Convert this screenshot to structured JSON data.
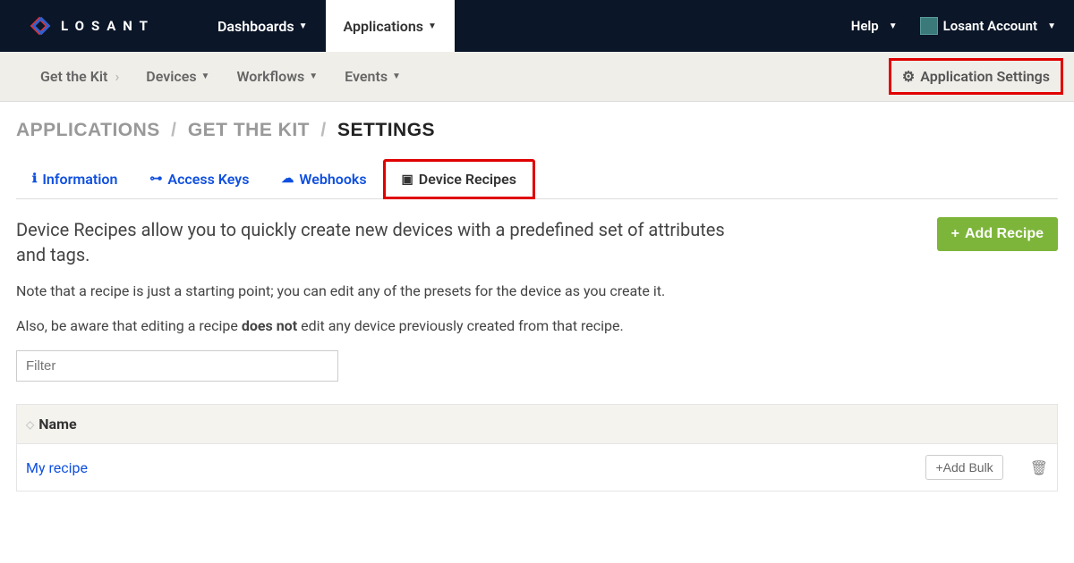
{
  "topnav": {
    "brand": "LOSANT",
    "dashboards": "Dashboards",
    "applications": "Applications",
    "help": "Help",
    "account": "Losant Account"
  },
  "subnav": {
    "kit": "Get the Kit",
    "devices": "Devices",
    "workflows": "Workflows",
    "events": "Events",
    "settings": "Application Settings"
  },
  "breadcrumb": {
    "p1": "APPLICATIONS",
    "p2": "GET THE KIT",
    "p3": "SETTINGS"
  },
  "tabs": {
    "information": "Information",
    "access_keys": "Access Keys",
    "webhooks": "Webhooks",
    "device_recipes": "Device Recipes"
  },
  "main": {
    "description": "Device Recipes allow you to quickly create new devices with a predefined set of attributes and tags.",
    "add_recipe": "Add Recipe",
    "note1": "Note that a recipe is just a starting point; you can edit any of the presets for the device as you create it.",
    "note2_a": "Also, be aware that editing a recipe ",
    "note2_bold": "does not",
    "note2_b": " edit any device previously created from that recipe.",
    "filter_placeholder": "Filter"
  },
  "table": {
    "col_name": "Name",
    "rows": [
      {
        "name": "My recipe",
        "add_bulk": "Add Bulk"
      }
    ]
  }
}
